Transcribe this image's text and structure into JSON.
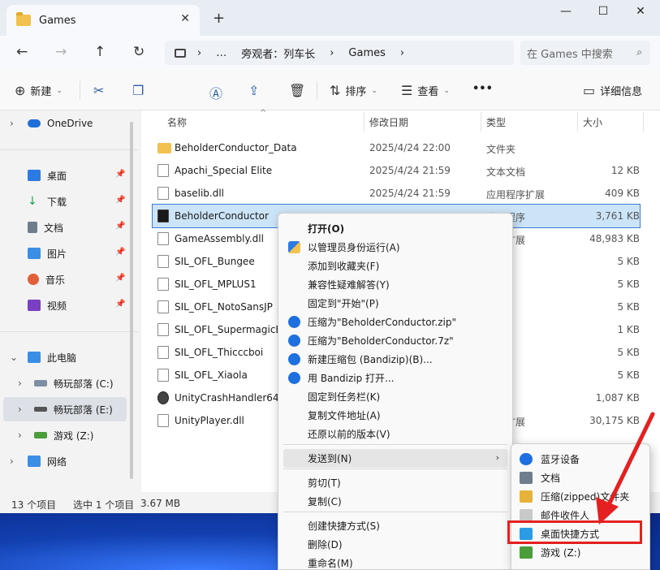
{
  "window": {
    "tab_title": "Games",
    "tab_close": "✕",
    "new_tab": "+",
    "minimize": "—",
    "maximize": "☐",
    "close": "✕"
  },
  "nav": {
    "back": "←",
    "forward": "→",
    "up": "↑",
    "refresh": "↻"
  },
  "address": {
    "more": "…",
    "sep1": "›",
    "crumb1": "旁观者：列车长",
    "sep2": "›",
    "crumb2": "Games",
    "sep3": "›"
  },
  "search": {
    "placeholder": "在 Games 中搜索",
    "icon": "⌕"
  },
  "toolbar": {
    "new_label": "新建",
    "sort_label": "排序",
    "view_label": "查看",
    "more": "•••",
    "details_label": "详细信息"
  },
  "sidebar": {
    "onedrive": "OneDrive",
    "quick": [
      {
        "label": "桌面",
        "color": "#2c7be5"
      },
      {
        "label": "下载",
        "color": "#1f9c4e"
      },
      {
        "label": "文档",
        "color": "#6f7d8c"
      },
      {
        "label": "图片",
        "color": "#3a8ee6"
      },
      {
        "label": "音乐",
        "color": "#e0603a"
      },
      {
        "label": "视频",
        "color": "#7a3fc2"
      }
    ],
    "this_pc": "此电脑",
    "drives": [
      {
        "label": "畅玩部落 (C:)"
      },
      {
        "label": "畅玩部落 (E:)"
      },
      {
        "label": "游戏 (Z:)"
      }
    ],
    "network": "网络"
  },
  "columns": {
    "name": "名称",
    "date": "修改日期",
    "type": "类型",
    "size": "大小"
  },
  "files": [
    {
      "name": "BeholderConductor_Data",
      "date": "2025/4/24 22:00",
      "type": "文件夹",
      "size": "",
      "icon": "folder"
    },
    {
      "name": "Apachi_Special Elite",
      "date": "2025/4/24 21:59",
      "type": "文本文档",
      "size": "12 KB",
      "icon": "doc"
    },
    {
      "name": "baselib.dll",
      "date": "2025/4/24 21:59",
      "type": "应用程序扩展",
      "size": "409 KB",
      "icon": "doc"
    },
    {
      "name": "BeholderConductor",
      "date": "",
      "type": "应用程序",
      "size": "3,761 KB",
      "icon": "exe"
    },
    {
      "name": "GameAssembly.dll",
      "date": "",
      "type": "程序扩展",
      "size": "48,983 KB",
      "icon": "doc"
    },
    {
      "name": "SIL_OFL_Bungee",
      "date": "",
      "type": "档",
      "size": "5 KB",
      "icon": "doc"
    },
    {
      "name": "SIL_OFL_MPLUS1",
      "date": "",
      "type": "档",
      "size": "5 KB",
      "icon": "doc"
    },
    {
      "name": "SIL_OFL_NotoSansJP",
      "date": "",
      "type": "档",
      "size": "5 KB",
      "icon": "doc"
    },
    {
      "name": "SIL_OFL_SupermagicB",
      "date": "",
      "type": "档",
      "size": "1 KB",
      "icon": "doc"
    },
    {
      "name": "SIL_OFL_Thicccboi",
      "date": "",
      "type": "档",
      "size": "5 KB",
      "icon": "doc"
    },
    {
      "name": "SIL_OFL_Xiaola",
      "date": "",
      "type": "档",
      "size": "5 KB",
      "icon": "doc"
    },
    {
      "name": "UnityCrashHandler64",
      "date": "",
      "type": "",
      "size": "1,087 KB",
      "icon": "unity"
    },
    {
      "name": "UnityPlayer.dll",
      "date": "",
      "type": "程序扩展",
      "size": "30,175 KB",
      "icon": "doc"
    }
  ],
  "status": {
    "count": "13 个项目",
    "selected": "选中 1 个项目",
    "size": "3.67 MB"
  },
  "context_menu": [
    {
      "label": "打开(O)",
      "bold": true,
      "icon": ""
    },
    {
      "label": "以管理员身份运行(A)",
      "icon": "shield"
    },
    {
      "label": "添加到收藏夹(F)",
      "icon": ""
    },
    {
      "label": "兼容性疑难解答(Y)",
      "icon": ""
    },
    {
      "label": "固定到\"开始\"(P)",
      "icon": ""
    },
    {
      "label": "压缩为\"BeholderConductor.zip\"",
      "icon": "bandizip"
    },
    {
      "label": "压缩为\"BeholderConductor.7z\"",
      "icon": "bandizip"
    },
    {
      "label": "新建压缩包 (Bandizip)(B)...",
      "icon": "bandizip"
    },
    {
      "label": "用 Bandizip 打开...",
      "icon": "bandizip"
    },
    {
      "label": "固定到任务栏(K)",
      "icon": ""
    },
    {
      "label": "复制文件地址(A)",
      "icon": ""
    },
    {
      "label": "还原以前的版本(V)",
      "icon": ""
    },
    {
      "label": "发送到(N)",
      "icon": "",
      "submenu": true
    },
    {
      "label": "剪切(T)",
      "icon": ""
    },
    {
      "label": "复制(C)",
      "icon": ""
    },
    {
      "label": "创建快捷方式(S)",
      "icon": ""
    },
    {
      "label": "删除(D)",
      "icon": ""
    },
    {
      "label": "重命名(M)",
      "icon": ""
    }
  ],
  "sendto_menu": [
    {
      "label": "蓝牙设备",
      "icon": "bluetooth"
    },
    {
      "label": "文档",
      "icon": "doc"
    },
    {
      "label": "压缩(zipped)文件夹",
      "icon": "zip"
    },
    {
      "label": "邮件收件人",
      "icon": "mail"
    },
    {
      "label": "桌面快捷方式",
      "icon": "desktop"
    },
    {
      "label": "游戏 (Z:)",
      "icon": "drive"
    }
  ],
  "colors": {
    "accent": "#3a7bd5",
    "selection": "#cce4f7",
    "highlight_box": "#e52020"
  }
}
